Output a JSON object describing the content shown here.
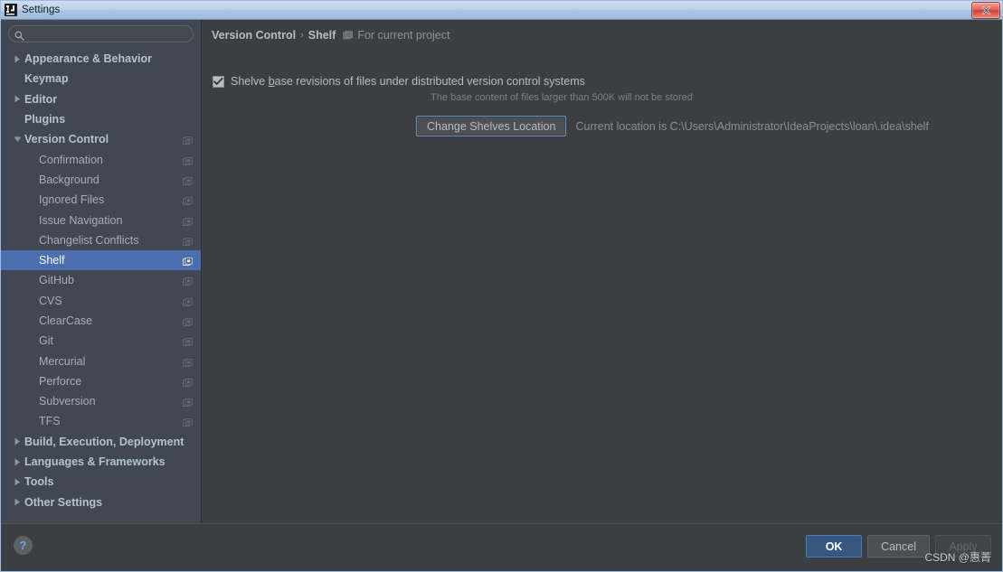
{
  "window": {
    "title": "Settings",
    "app_icon": "intellij-idea-icon",
    "close_label": "close-window"
  },
  "search": {
    "value": "",
    "placeholder": "",
    "icon": "search-icon"
  },
  "sidebar": {
    "items": [
      {
        "label": "Appearance & Behavior",
        "level": "top",
        "expander": "collapsed",
        "project_icon": false
      },
      {
        "label": "Keymap",
        "level": "top",
        "expander": "none",
        "project_icon": false
      },
      {
        "label": "Editor",
        "level": "top",
        "expander": "collapsed",
        "project_icon": false
      },
      {
        "label": "Plugins",
        "level": "top",
        "expander": "none",
        "project_icon": false
      },
      {
        "label": "Version Control",
        "level": "top",
        "expander": "expanded",
        "project_icon": true
      },
      {
        "label": "Confirmation",
        "level": "child",
        "expander": "none",
        "project_icon": true
      },
      {
        "label": "Background",
        "level": "child",
        "expander": "none",
        "project_icon": true
      },
      {
        "label": "Ignored Files",
        "level": "child",
        "expander": "none",
        "project_icon": true
      },
      {
        "label": "Issue Navigation",
        "level": "child",
        "expander": "none",
        "project_icon": true
      },
      {
        "label": "Changelist Conflicts",
        "level": "child",
        "expander": "none",
        "project_icon": true
      },
      {
        "label": "Shelf",
        "level": "child",
        "expander": "none",
        "project_icon": true,
        "selected": true
      },
      {
        "label": "GitHub",
        "level": "child",
        "expander": "none",
        "project_icon": true
      },
      {
        "label": "CVS",
        "level": "child",
        "expander": "none",
        "project_icon": true
      },
      {
        "label": "ClearCase",
        "level": "child",
        "expander": "none",
        "project_icon": true
      },
      {
        "label": "Git",
        "level": "child",
        "expander": "none",
        "project_icon": true
      },
      {
        "label": "Mercurial",
        "level": "child",
        "expander": "none",
        "project_icon": true
      },
      {
        "label": "Perforce",
        "level": "child",
        "expander": "none",
        "project_icon": true
      },
      {
        "label": "Subversion",
        "level": "child",
        "expander": "none",
        "project_icon": true
      },
      {
        "label": "TFS",
        "level": "child",
        "expander": "none",
        "project_icon": true
      },
      {
        "label": "Build, Execution, Deployment",
        "level": "top",
        "expander": "collapsed",
        "project_icon": false
      },
      {
        "label": "Languages & Frameworks",
        "level": "top",
        "expander": "collapsed",
        "project_icon": false
      },
      {
        "label": "Tools",
        "level": "top",
        "expander": "collapsed",
        "project_icon": false
      },
      {
        "label": "Other Settings",
        "level": "top",
        "expander": "collapsed",
        "project_icon": false
      }
    ]
  },
  "main": {
    "breadcrumb": {
      "parent": "Version Control",
      "separator": "›",
      "current": "Shelf",
      "scope_icon": "project-scope-icon",
      "scope": "For current project"
    },
    "shelve_option": {
      "checked": true,
      "label_before": "Shelve ",
      "label_mnemonic": "b",
      "label_after": "ase revisions of files under distributed version control systems",
      "hint": "The base content of files larger than 500K will not be stored"
    },
    "location": {
      "button_label": "Change Shelves Location",
      "text": "Current location is C:\\Users\\Administrator\\IdeaProjects\\loan\\.idea\\shelf"
    }
  },
  "footer": {
    "help_label": "?",
    "buttons": [
      {
        "label": "OK",
        "style": "default"
      },
      {
        "label": "Cancel",
        "style": "normal"
      },
      {
        "label": "Apply",
        "style": "disabled"
      }
    ]
  },
  "watermark": "CSDN @惠菁",
  "colors": {
    "selection": "#4b6eaf",
    "sidebar_bg": "#414753",
    "content_bg": "#3c3f41",
    "accent_button": "#365880",
    "titlebar": "#a9c4e0",
    "close_button": "#cf4233",
    "text": "#a9b7c6"
  }
}
